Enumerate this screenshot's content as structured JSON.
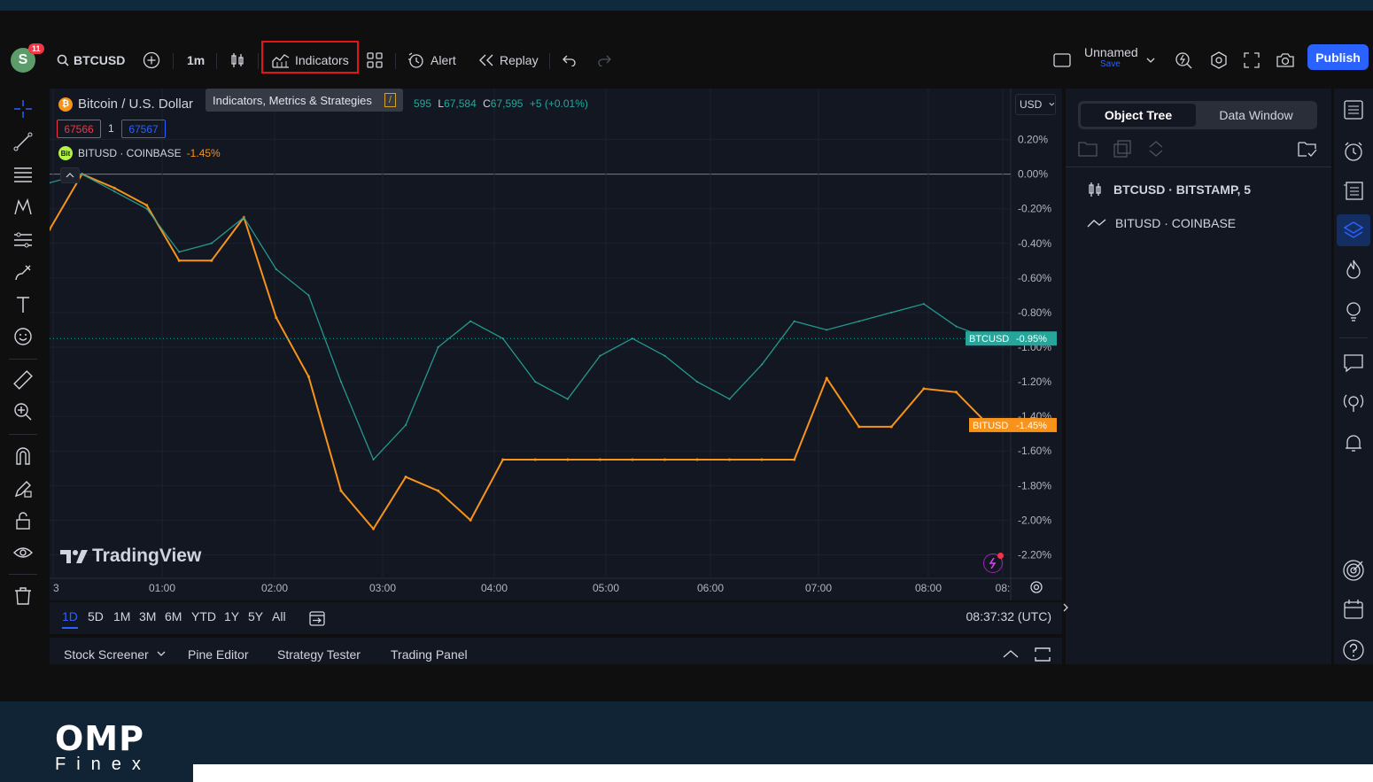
{
  "topbar": {
    "avatar_letter": "S",
    "notif_count": "11",
    "symbol": "BTCUSD",
    "interval": "1m",
    "indicators_label": "Indicators",
    "alert_label": "Alert",
    "replay_label": "Replay",
    "layout_name": "Unnamed",
    "layout_sub": "Save",
    "publish_label": "Publish"
  },
  "tooltip": {
    "text": "Indicators, Metrics & Strategies",
    "shortcut": "/"
  },
  "legend": {
    "title": "Bitcoin / U.S. Dollar",
    "ohlc_tail": "595",
    "low_label": "L",
    "low_value": "67,584",
    "close_label": "C",
    "close_value": "67,595",
    "change": "+5 (+0.01%)",
    "bid": "67566",
    "spread": "1",
    "ask": "67567",
    "compare_symbol": "BITUSD · COINBASE",
    "compare_change": "-1.45%"
  },
  "currency": "USD",
  "chart_data": {
    "type": "line",
    "x": [
      "00:30",
      "00:45",
      "01:00",
      "01:15",
      "01:30",
      "01:45",
      "02:00",
      "02:15",
      "02:30",
      "02:45",
      "03:00",
      "03:15",
      "03:30",
      "03:35",
      "03:40",
      "03:45",
      "04:00",
      "04:30",
      "05:00",
      "05:30",
      "06:00",
      "06:30",
      "07:00",
      "07:30",
      "07:45",
      "07:50",
      "08:00",
      "08:15",
      "08:20",
      "08:25"
    ],
    "y_ticks": [
      "0.20%",
      "0.00%",
      "-0.20%",
      "-0.40%",
      "-0.60%",
      "-0.80%",
      "-1.00%",
      "-1.20%",
      "-1.40%",
      "-1.60%",
      "-1.80%",
      "-2.00%",
      "-2.20%"
    ],
    "x_ticks": [
      "3",
      "01:00",
      "02:00",
      "03:00",
      "04:00",
      "05:00",
      "06:00",
      "07:00",
      "08:00",
      "08:"
    ],
    "ylim": [
      -2.3,
      0.3
    ],
    "series": [
      {
        "name": "BITUSD",
        "color": "#f7931a",
        "values": [
          -0.32,
          0.0,
          -0.08,
          -0.18,
          -0.5,
          -0.5,
          -0.25,
          -0.83,
          -1.17,
          -1.83,
          -2.05,
          -1.75,
          -1.83,
          -2.0,
          -1.65,
          -1.65,
          -1.65,
          -1.65,
          -1.65,
          -1.65,
          -1.65,
          -1.65,
          -1.65,
          -1.65,
          -1.18,
          -1.46,
          -1.46,
          -1.24,
          -1.26,
          -1.45
        ]
      },
      {
        "name": "BTCUSD",
        "color": "#26a69a",
        "values": [
          -0.05,
          0.0,
          -0.1,
          -0.2,
          -0.45,
          -0.4,
          -0.25,
          -0.55,
          -0.7,
          -1.2,
          -1.65,
          -1.45,
          -1.0,
          -0.85,
          -0.95,
          -1.2,
          -1.3,
          -1.05,
          -0.95,
          -1.05,
          -1.2,
          -1.3,
          -1.1,
          -0.85,
          -0.9,
          -0.85,
          -0.8,
          -0.75,
          -0.88,
          -0.95
        ]
      }
    ],
    "last_labels": [
      {
        "name": "BTCUSD",
        "value": "-0.95%"
      },
      {
        "name": "BITUSD",
        "value": "-1.45%"
      }
    ],
    "zero_line": "0.00%"
  },
  "watermark": "TradingView",
  "timeframes": [
    "1D",
    "5D",
    "1M",
    "3M",
    "6M",
    "YTD",
    "1Y",
    "5Y",
    "All"
  ],
  "clock": "08:37:32 (UTC)",
  "bottom_tabs": [
    "Stock Screener",
    "Pine Editor",
    "Strategy Tester",
    "Trading Panel"
  ],
  "right_panel": {
    "tab_active": "Object Tree",
    "tab_other": "Data Window",
    "items": [
      "BTCUSD · BITSTAMP, 5",
      "BITUSD · COINBASE"
    ]
  },
  "footer": {
    "brand_top": "OMP",
    "brand_bottom": "Finex"
  }
}
